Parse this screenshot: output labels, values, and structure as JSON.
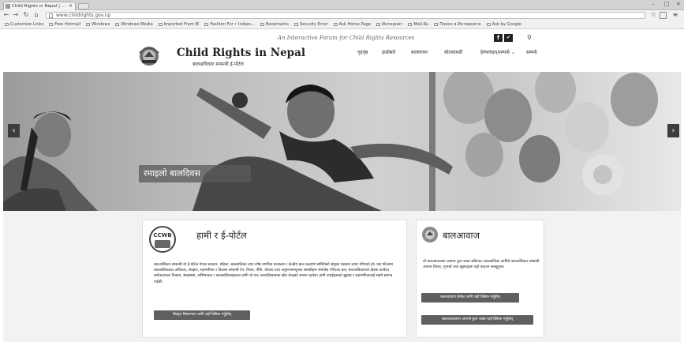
{
  "browser": {
    "tab_title": "Child Rights in Nepal | ...",
    "url": "www.childrights.gov.np",
    "bookmarks": [
      {
        "label": "Customize Links",
        "icon": "folder-icon"
      },
      {
        "label": "Free Hotmail",
        "icon": "page-icon"
      },
      {
        "label": "Windows",
        "icon": "page-icon"
      },
      {
        "label": "Windows Media",
        "icon": "page-icon"
      },
      {
        "label": "Imported From IE",
        "icon": "folder-icon"
      },
      {
        "label": "Fashion For • Indian...",
        "icon": "page-icon"
      },
      {
        "label": "Bookmarks",
        "icon": "star-icon"
      },
      {
        "label": "Security Error",
        "icon": "page-icon"
      },
      {
        "label": "Ask Home Page",
        "icon": "page-icon"
      },
      {
        "label": "Интернет",
        "icon": "page-icon"
      },
      {
        "label": "Mail.Ru",
        "icon": "mail-icon"
      },
      {
        "label": "Поиск в Интернете",
        "icon": "search-icon"
      },
      {
        "label": "Ask by Google",
        "icon": "page-icon"
      }
    ]
  },
  "header": {
    "tagline": "An Interactive Forum for Child Rights Resources",
    "title": "Child Rights in Nepal",
    "subtitle": "बालअधिकार सम्बन्धी ई-पोर्टल",
    "nav": [
      {
        "label": "गृहपृष्ठ"
      },
      {
        "label": "हाम्रोबारे"
      },
      {
        "label": "बालवाचन"
      },
      {
        "label": "स्रोतसामग्री"
      },
      {
        "label": "हेल्पलाइन/सम्पर्क ⌄"
      },
      {
        "label": "सम्पर्क"
      }
    ]
  },
  "hero": {
    "caption": "रमाइलाे बालदिवस",
    "prev_label": "‹",
    "next_label": "›"
  },
  "intro_card": {
    "title": "हामी र ई-पोर्टल",
    "text": "बालअधिकार सम्बन्धी यो ई-पोर्टल नेपाल सरकार, महिला, बालबालिका तथा ज्येष्ठ नागरिक मन्त्रालय र केन्द्रीय बाल कल्याण समितिको संयुक्त पहलमा तयार गरिएको हो। यस पोर्टलमा बालबालिकाका अधिकार, संरक्षण, सहभागिता र विकास सम्बन्धी ऐन, नियम, नीति, योजना तथा अनुसन्धानमूलक सामग्रीहरू समावेश गरिएका छन्। बालअधिकारको क्षेत्रमा कार्यरत सरोकारवाला निकाय, संघसंस्था, अभिभावक र बालबालिकाहरूका लागि यो एक अन्तरक्रियात्मक स्रोत केन्द्रको रूपमा रहनेछ। हामी तपाईंहरूको सुझाव र सहभागितालाई सहर्ष स्वागत गर्दछौं।",
    "button": "विस्तृत विवरणका लागि यहाँ क्लिक गर्नुहोस्"
  },
  "voice_card": {
    "title": "बालआवाज",
    "text": "यो बालआवाजमा आफ्ना कुरा राख्न सकिन्छ। बालबालिका आफैँले बालअधिकार सम्बन्धी आफ्ना विचार, गुनासो तथा सुझावहरू यहाँ पठाउन सक्नुहुन्छ।",
    "button1": "बालआवाज हेर्नका लागि यहाँ क्लिक गर्नुहोस्",
    "button2": "बालआवाजमा आफ्नो कुरा राख्न यहाँ क्लिक गर्नुहोस्"
  }
}
